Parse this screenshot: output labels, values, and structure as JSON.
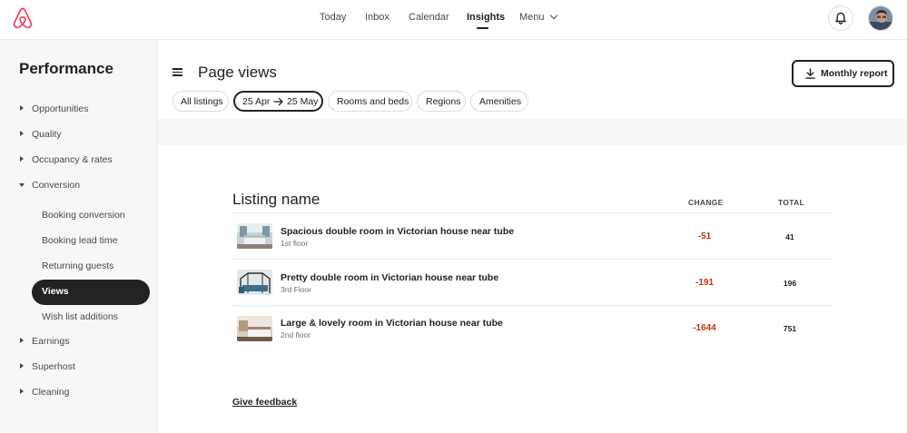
{
  "colors": {
    "brand": "#FF385C",
    "negative": "#C13515",
    "dark": "#222222"
  },
  "topnav": {
    "items": [
      "Today",
      "Inbox",
      "Calendar",
      "Insights"
    ],
    "active": "Insights",
    "menu_label": "Menu",
    "icons": [
      "airbnb-logo",
      "bell-icon",
      "user-avatar"
    ]
  },
  "sidebar": {
    "title": "Performance",
    "items": [
      {
        "label": "Opportunities",
        "expanded": false
      },
      {
        "label": "Quality",
        "expanded": false
      },
      {
        "label": "Occupancy & rates",
        "expanded": false
      },
      {
        "label": "Conversion",
        "expanded": true
      },
      {
        "label": "Earnings",
        "expanded": false
      },
      {
        "label": "Superhost",
        "expanded": false
      },
      {
        "label": "Cleaning",
        "expanded": false
      }
    ],
    "conversion_sub": [
      {
        "label": "Booking conversion",
        "active": false
      },
      {
        "label": "Booking lead time",
        "active": false
      },
      {
        "label": "Returning guests",
        "active": false
      },
      {
        "label": "Views",
        "active": true
      },
      {
        "label": "Wish list additions",
        "active": false
      }
    ]
  },
  "header": {
    "title": "Page views",
    "report_button": "Monthly report"
  },
  "filters": {
    "all_listings": "All listings",
    "date_from": "25 Apr",
    "date_to": "25 May",
    "rooms": "Rooms and beds",
    "regions": "Regions",
    "amenities": "Amenities"
  },
  "table": {
    "title": "Listing name",
    "col_change": "CHANGE",
    "col_total": "TOTAL",
    "rows": [
      {
        "name": "Spacious double room in Victorian house near tube",
        "floor": "1st floor",
        "change": "-51",
        "total": "41"
      },
      {
        "name": "Pretty double room in Victorian house near tube",
        "floor": "3rd Floor",
        "change": "-191",
        "total": "196"
      },
      {
        "name": "Large & lovely room in Victorian house near tube",
        "floor": "2nd floor",
        "change": "-1644",
        "total": "751"
      }
    ]
  },
  "footer": {
    "feedback": "Give feedback"
  }
}
